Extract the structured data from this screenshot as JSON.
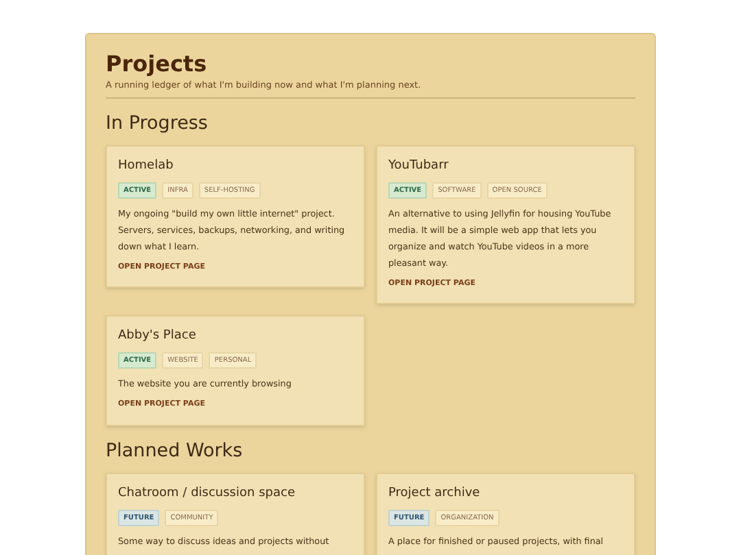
{
  "title": "Projects",
  "subtitle": "A running ledger of what I'm building now and what I'm planning next.",
  "sections": [
    {
      "heading": "In Progress",
      "projects": [
        {
          "name": "Homelab",
          "tags": [
            {
              "label": "ACTIVE",
              "kind": "active"
            },
            {
              "label": "INFRA",
              "kind": "topic"
            },
            {
              "label": "SELF-HOSTING",
              "kind": "topic"
            }
          ],
          "description": "My ongoing \"build my own little internet\" project. Servers, services, backups, networking, and writing down what I learn.",
          "link": "OPEN PROJECT PAGE"
        },
        {
          "name": "YouTubarr",
          "tags": [
            {
              "label": "ACTIVE",
              "kind": "active"
            },
            {
              "label": "SOFTWARE",
              "kind": "topic"
            },
            {
              "label": "OPEN SOURCE",
              "kind": "topic"
            }
          ],
          "description": "An alternative to using Jellyfin for housing YouTube media. It will be a simple web app that lets you organize and watch YouTube videos in a more pleasant way.",
          "link": "OPEN PROJECT PAGE"
        },
        {
          "name": "Abby's Place",
          "tags": [
            {
              "label": "ACTIVE",
              "kind": "active"
            },
            {
              "label": "WEBSITE",
              "kind": "topic"
            },
            {
              "label": "PERSONAL",
              "kind": "topic"
            }
          ],
          "description": "The website you are currently browsing",
          "link": "OPEN PROJECT PAGE"
        }
      ]
    },
    {
      "heading": "Planned Works",
      "projects": [
        {
          "name": "Chatroom / discussion space",
          "tags": [
            {
              "label": "FUTURE",
              "kind": "future"
            },
            {
              "label": "COMMUNITY",
              "kind": "topic"
            }
          ],
          "description": "Some way to discuss ideas and projects without"
        },
        {
          "name": "Project archive",
          "tags": [
            {
              "label": "FUTURE",
              "kind": "future"
            },
            {
              "label": "ORGANIZATION",
              "kind": "topic"
            }
          ],
          "description": "A place for finished or paused projects, with final"
        }
      ]
    }
  ]
}
